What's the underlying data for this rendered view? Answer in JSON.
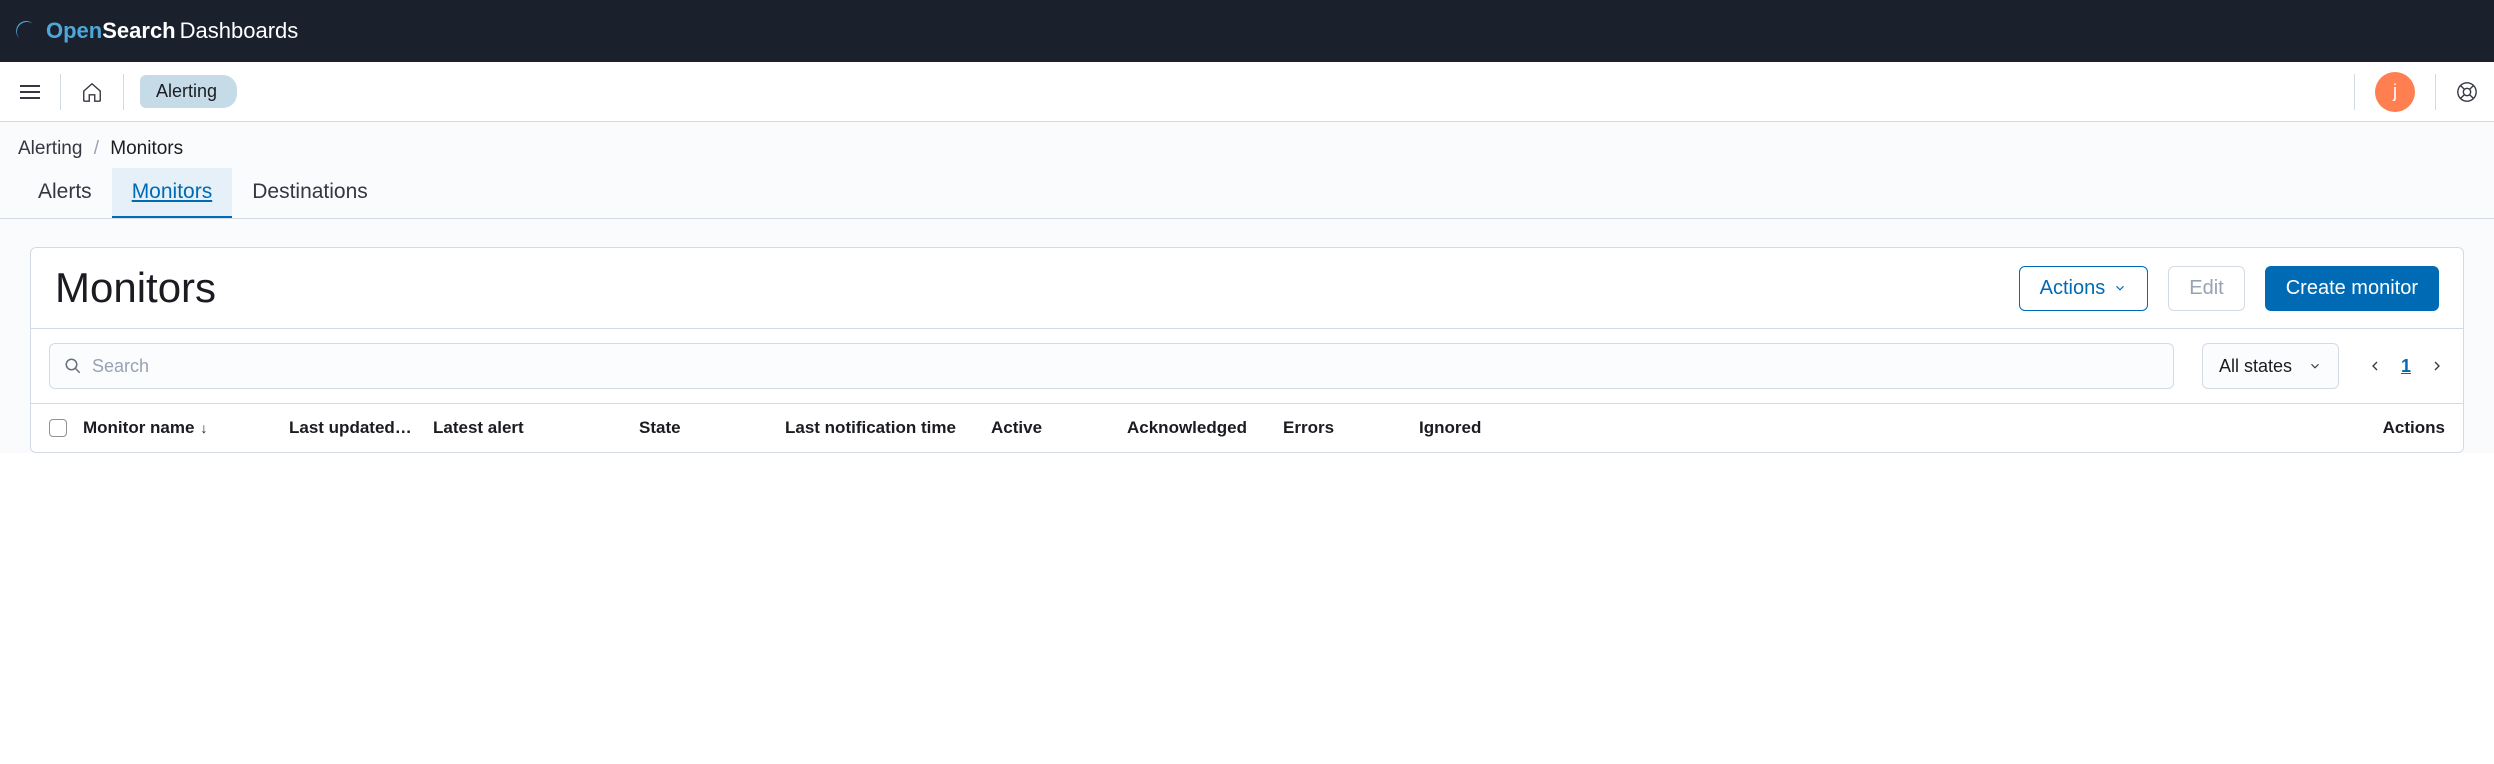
{
  "header": {
    "logo_open": "Open",
    "logo_search": "Search",
    "logo_dashboards": "Dashboards"
  },
  "nav": {
    "chip": "Alerting",
    "avatar_initial": "j"
  },
  "breadcrumbs": {
    "root": "Alerting",
    "current": "Monitors"
  },
  "tabs": {
    "alerts": "Alerts",
    "monitors": "Monitors",
    "destinations": "Destinations"
  },
  "panel": {
    "title": "Monitors",
    "actions_btn": "Actions",
    "edit_btn": "Edit",
    "create_btn": "Create monitor"
  },
  "controls": {
    "search_placeholder": "Search",
    "state_label": "All states",
    "page": "1"
  },
  "table": {
    "headers": {
      "name": "Monitor name",
      "updated": "Last updated…",
      "latest": "Latest alert",
      "state": "State",
      "notif": "Last notification time",
      "active": "Active",
      "ack": "Acknowledged",
      "errors": "Errors",
      "ignored": "Ignored",
      "actions": "Actions"
    }
  }
}
